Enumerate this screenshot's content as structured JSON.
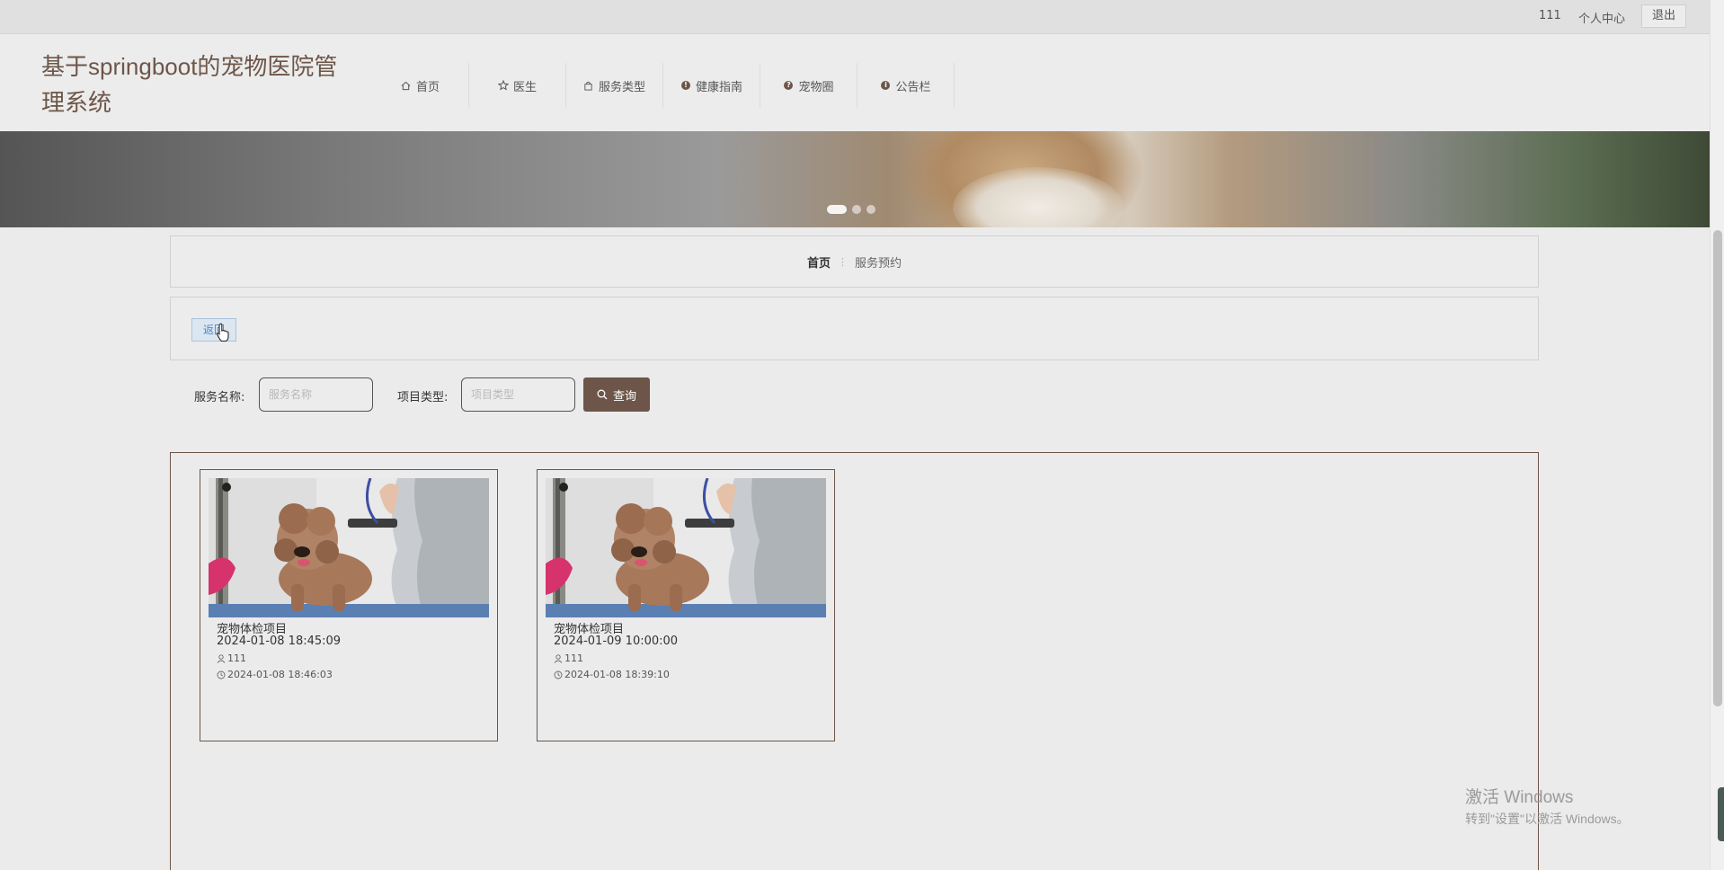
{
  "topbar": {
    "username": "111",
    "personal_center": "个人中心",
    "logout": "退出"
  },
  "header": {
    "site_title": "基于springboot的宠物医院管理系统",
    "nav": [
      {
        "label": "首页",
        "icon": "home-icon"
      },
      {
        "label": "医生",
        "icon": "star-icon"
      },
      {
        "label": "服务类型",
        "icon": "bag-icon"
      },
      {
        "label": "健康指南",
        "icon": "exclamation-circle-icon"
      },
      {
        "label": "宠物圈",
        "icon": "question-circle-icon"
      },
      {
        "label": "公告栏",
        "icon": "info-circle-icon"
      }
    ]
  },
  "banner": {
    "slide_count": 3,
    "active_slide": 1
  },
  "breadcrumb": {
    "home": "首页",
    "separator": "⋮",
    "current": "服务预约"
  },
  "actions": {
    "back_label": "返回"
  },
  "search": {
    "name_label": "服务名称:",
    "name_placeholder": "服务名称",
    "type_label": "项目类型:",
    "type_placeholder": "项目类型",
    "button_label": "查询"
  },
  "cards": [
    {
      "title": "宠物体检项目",
      "appointment_time": "2024-01-08 18:45:09",
      "user": "111",
      "created": "2024-01-08 18:46:03"
    },
    {
      "title": "宠物体检项目",
      "appointment_time": "2024-01-09 10:00:00",
      "user": "111",
      "created": "2024-01-08 18:39:10"
    }
  ],
  "watermark": {
    "line1": "激活 Windows",
    "line2": "转到\"设置\"以激活 Windows。"
  },
  "colors": {
    "accent": "#6d5649",
    "back_button": "#4f86c6"
  }
}
